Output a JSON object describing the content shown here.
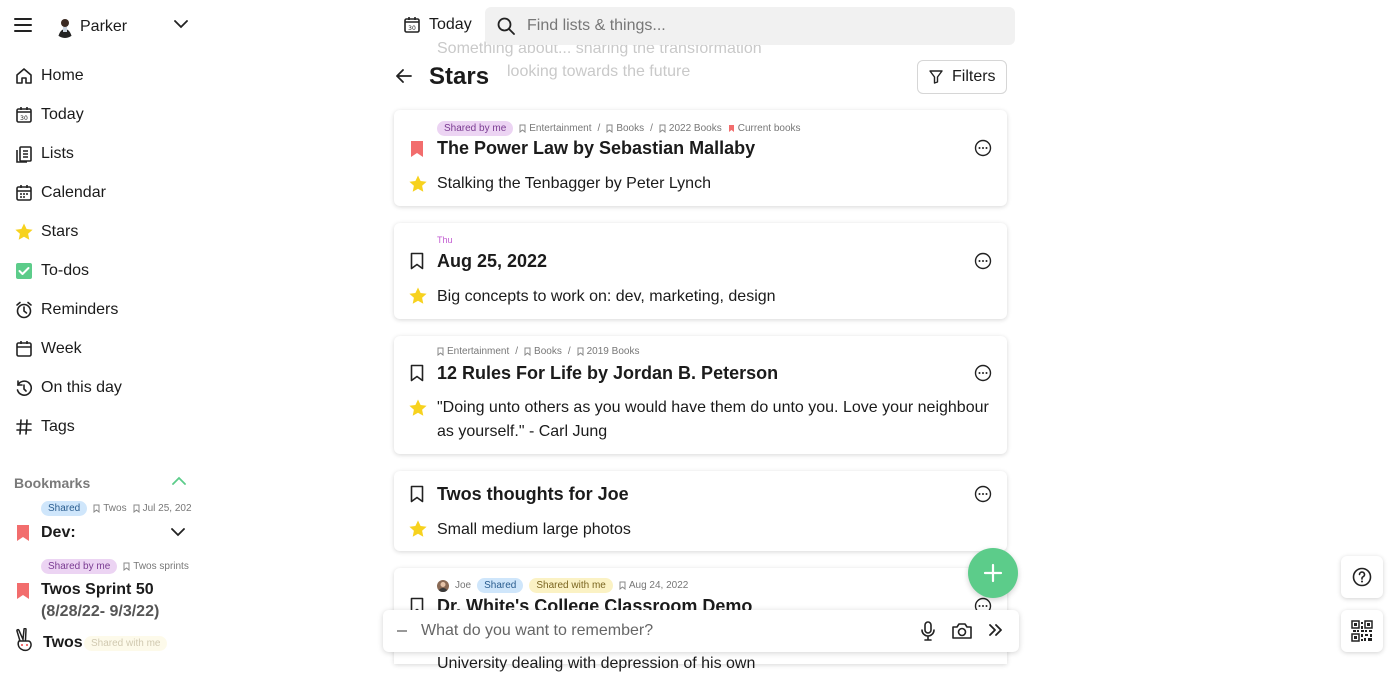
{
  "user": {
    "name": "Parker"
  },
  "nav": {
    "items": [
      {
        "label": "Home",
        "icon": "home-icon"
      },
      {
        "label": "Today",
        "icon": "calendar-day-icon"
      },
      {
        "label": "Lists",
        "icon": "lists-icon"
      },
      {
        "label": "Calendar",
        "icon": "calendar-icon"
      },
      {
        "label": "Stars",
        "icon": "star-icon"
      },
      {
        "label": "To-dos",
        "icon": "checkbox-icon"
      },
      {
        "label": "Reminders",
        "icon": "alarm-icon"
      },
      {
        "label": "Week",
        "icon": "week-icon"
      },
      {
        "label": "On this day",
        "icon": "history-icon"
      },
      {
        "label": "Tags",
        "icon": "hash-icon"
      }
    ]
  },
  "bookmarks": {
    "heading": "Bookmarks",
    "items": [
      {
        "badge": "Shared",
        "crumbs": [
          "Twos",
          "Jul 25, 202"
        ],
        "title": "Dev:"
      },
      {
        "badge": "Shared by me",
        "crumbs": [
          "Twos sprints"
        ],
        "title": "Twos Sprint 50",
        "title_line2": "(8/28/22- 9/3/22)"
      },
      {
        "badge": "Shared with me",
        "title": "Twos"
      }
    ]
  },
  "topbar": {
    "today_label": "Today",
    "today_date": "30",
    "search_placeholder": "Find lists & things..."
  },
  "ghost_text": {
    "line1": "Something about... sharing the transformation",
    "line2": "looking towards the future"
  },
  "page": {
    "title": "Stars",
    "filters_label": "Filters"
  },
  "cards": [
    {
      "badge": "Shared by me",
      "crumbs": [
        "Entertainment",
        "Books",
        "2022 Books"
      ],
      "tag": "Current books",
      "title": "The Power Law by Sebastian Mallaby",
      "starred": "Stalking the Tenbagger by Peter Lynch"
    },
    {
      "day": "Thu",
      "title": "Aug 25, 2022",
      "starred": "Big concepts to work on: dev, marketing, design"
    },
    {
      "crumbs": [
        "Entertainment",
        "Books",
        "2019 Books"
      ],
      "title": "12 Rules For Life by Jordan B. Peterson",
      "starred_line1": "\"Doing unto others as you would have them do unto you. Love your neighbour",
      "starred_line2": "as yourself.\" - Carl Jung"
    },
    {
      "title": "Twos thoughts for Joe",
      "starred": "Small medium large photos"
    },
    {
      "owner": "Joe",
      "badge": "Shared",
      "badge2": "Shared with me",
      "date": "Aug 24, 2022",
      "title": "Dr. White's College Classroom Demo",
      "starred": "University dealing with depression of his own"
    }
  ],
  "composer": {
    "placeholder": "What do you want to remember?"
  },
  "colors": {
    "accent_green": "#5ccc8a",
    "star_yellow": "#f7d21e",
    "bookmark_red": "#f26d6d"
  }
}
